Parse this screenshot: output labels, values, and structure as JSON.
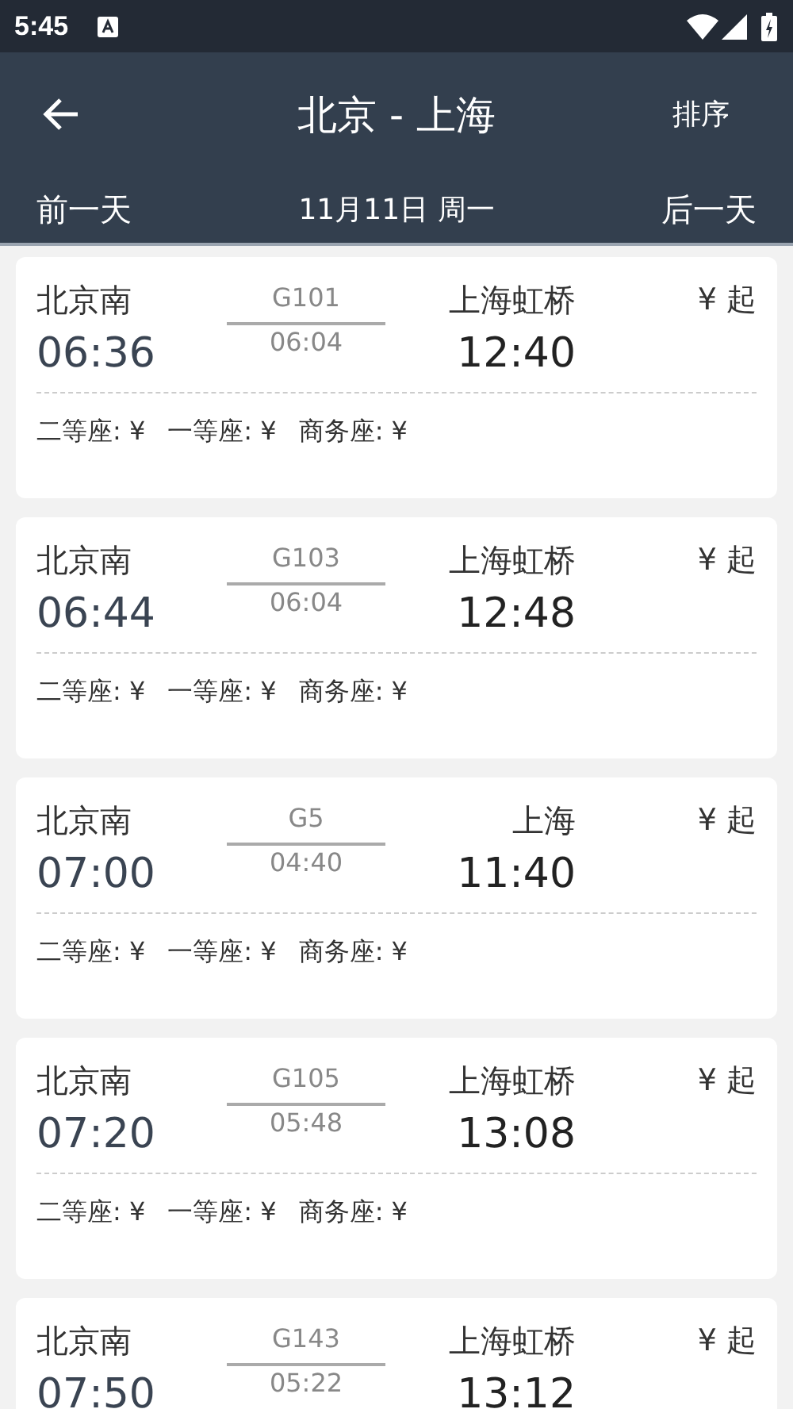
{
  "status_bar": {
    "time": "5:45"
  },
  "header": {
    "title": "北京 - 上海",
    "sort": "排序",
    "prev_day": "前一天",
    "date": "11月11日 周一",
    "next_day": "后一天"
  },
  "trains": [
    {
      "from": "北京南",
      "number": "G101",
      "duration": "06:04",
      "to": "上海虹桥",
      "price": "¥ 起",
      "depart": "06:36",
      "arrive": "12:40",
      "seats": [
        "二等座: ¥",
        "一等座: ¥",
        "商务座: ¥"
      ]
    },
    {
      "from": "北京南",
      "number": "G103",
      "duration": "06:04",
      "to": "上海虹桥",
      "price": "¥ 起",
      "depart": "06:44",
      "arrive": "12:48",
      "seats": [
        "二等座: ¥",
        "一等座: ¥",
        "商务座: ¥"
      ]
    },
    {
      "from": "北京南",
      "number": "G5",
      "duration": "04:40",
      "to": "上海",
      "price": "¥ 起",
      "depart": "07:00",
      "arrive": "11:40",
      "seats": [
        "二等座: ¥",
        "一等座: ¥",
        "商务座: ¥"
      ]
    },
    {
      "from": "北京南",
      "number": "G105",
      "duration": "05:48",
      "to": "上海虹桥",
      "price": "¥ 起",
      "depart": "07:20",
      "arrive": "13:08",
      "seats": [
        "二等座: ¥",
        "一等座: ¥",
        "商务座: ¥"
      ]
    },
    {
      "from": "北京南",
      "number": "G143",
      "duration": "05:22",
      "to": "上海虹桥",
      "price": "¥ 起",
      "depart": "07:50",
      "arrive": "13:12"
    }
  ]
}
